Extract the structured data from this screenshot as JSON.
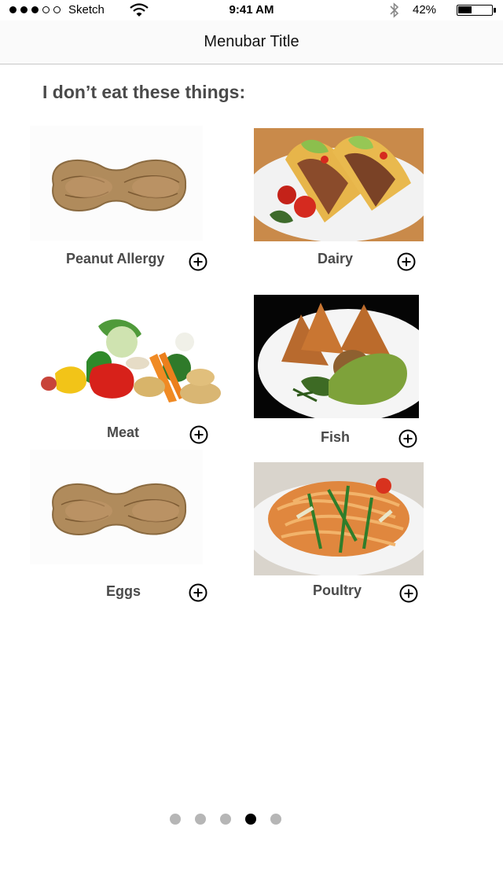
{
  "status_bar": {
    "carrier": "Sketch",
    "time": "9:41 AM",
    "battery_percent": "42%",
    "battery_level": 0.42,
    "signal_bars_filled": 3,
    "signal_bars_total": 5
  },
  "navbar": {
    "title": "Menubar Title"
  },
  "heading": "I don’t eat these things:",
  "items": [
    {
      "label": "Peanut Allergy",
      "image": "peanut"
    },
    {
      "label": "Dairy",
      "image": "tacos"
    },
    {
      "label": "Meat",
      "image": "vegetables"
    },
    {
      "label": "Fish",
      "image": "samosa"
    },
    {
      "label": "Eggs",
      "image": "peanut"
    },
    {
      "label": "Poultry",
      "image": "noodles"
    }
  ],
  "add_icon": "plus-circle-icon",
  "pagination": {
    "total": 5,
    "active_index": 3
  },
  "colors": {
    "text": "#4a4a4a",
    "active_dot": "#000000",
    "inactive_dot": "#b6b6b6"
  }
}
